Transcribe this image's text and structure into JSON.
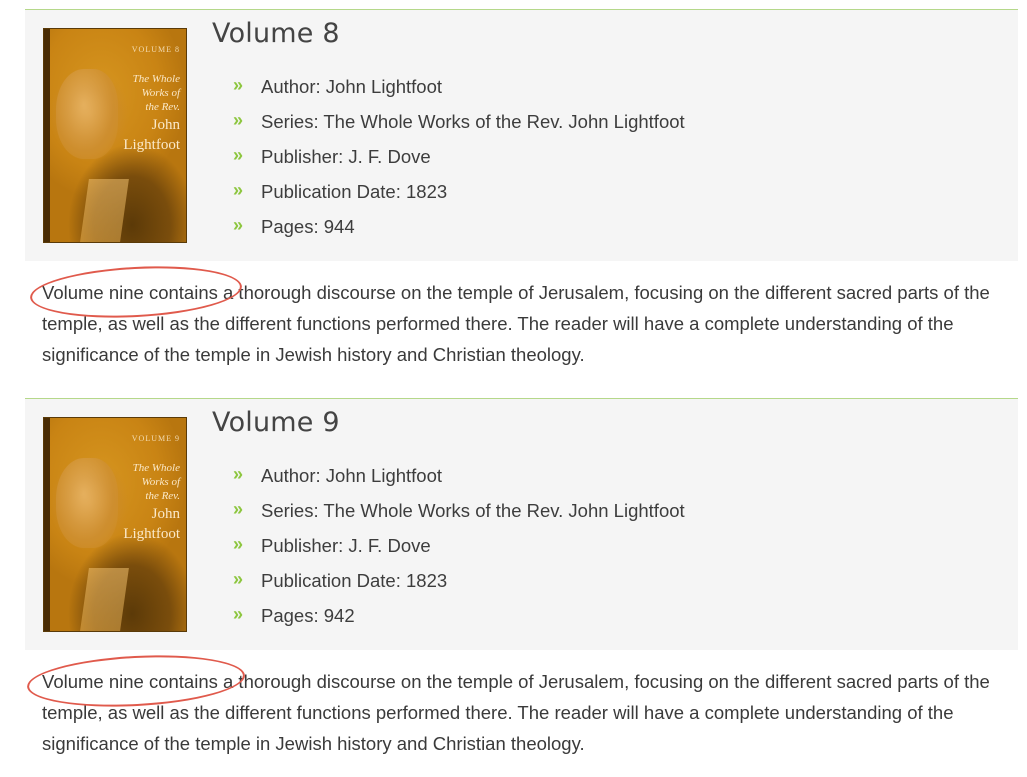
{
  "volumes": [
    {
      "title": "Volume 8",
      "cover": {
        "volume_label": "VOLUME 8",
        "series_line_1": "The Whole",
        "series_line_2": "Works of",
        "series_line_3": "the Rev.",
        "author_line_1": "John",
        "author_line_2": "Lightfoot"
      },
      "meta": [
        {
          "text": "Author: John Lightfoot"
        },
        {
          "text": "Series: The Whole Works of the Rev. John Lightfoot"
        },
        {
          "text": "Publisher: J. F. Dove"
        },
        {
          "text": "Publication Date: 1823"
        },
        {
          "text": "Pages: 944"
        }
      ],
      "description": "Volume nine contains a thorough discourse on the temple of Jerusalem, focusing on the different sacred parts of the temple, as well as the different functions performed there. The reader will have a complete understanding of the significance of the temple in Jewish history and Christian theology."
    },
    {
      "title": "Volume 9",
      "cover": {
        "volume_label": "VOLUME 9",
        "series_line_1": "The Whole",
        "series_line_2": "Works of",
        "series_line_3": "the Rev.",
        "author_line_1": "John",
        "author_line_2": "Lightfoot"
      },
      "meta": [
        {
          "text": "Author: John Lightfoot"
        },
        {
          "text": "Series: The Whole Works of the Rev. John Lightfoot"
        },
        {
          "text": "Publisher: J. F. Dove"
        },
        {
          "text": "Publication Date: 1823"
        },
        {
          "text": "Pages: 942"
        }
      ],
      "description": "Volume nine contains a thorough discourse on the temple of Jerusalem, focusing on the different sacred parts of the temple, as well as the different functions performed there. The reader will have a complete understanding of the significance of the temple in Jewish history and Christian theology."
    }
  ],
  "bullet_glyph": "»",
  "colors": {
    "accent": "#8dc63f",
    "divider": "#b5d88a",
    "header_bg": "#f5f5f5",
    "annotation": "#e05a4c"
  }
}
